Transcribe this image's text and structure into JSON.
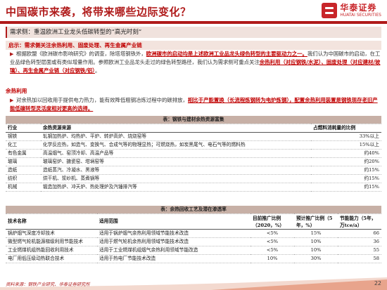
{
  "header": {
    "title": "中国碳市来袭，将带来哪些边际变化？",
    "logo_cn": "华泰证券",
    "logo_en": "HUATAI SECURITIES"
  },
  "section_title": "需求侧：重温欧洲工业龙头低碳转型的“高光时刻”",
  "part1": {
    "heading": "启示：需求侧关注余热利用、固废处理、再生金属产业链",
    "p1_a": "根据欧盟《欧洲碳市影响研究》的调查，除塔塔钢铁外，",
    "p1_b": "欧洲碳市的启动均是上述欧洲工业品龙头绿色转型的主要驱动力之一。",
    "p1_c": "我们认为中国碳市的启动，在工业品绿色转型层面或有类似增量作用。参照欧洲工业品龙头走过的绿色转型路径，我们认为需求侧可重点关注",
    "p1_d": "余热利用（对应钢铁/水泥）、固废处理（对应建材/玻璃）、再生金属产业链（对应钢铁/铝）",
    "p1_e": "。"
  },
  "part2": {
    "heading": "余热利用",
    "p2_a": "对余热加以回收用于提供电力热力，能有效降低粗钢冶炼过程中的碳排放，",
    "p2_b": "相比于产能置换（长流程炼钢转为电炉炼钢），配置余热利用装置是钢铁现存老旧产能低碳转型灵活度相对更高的选择。"
  },
  "table1": {
    "caption": "表：钢铁与建材余热资源富集",
    "columns": [
      "行业",
      "余热资源来源",
      "占燃料消耗量的比例"
    ],
    "rows": [
      [
        "钢铁",
        "轧钢加热炉、均热炉、平炉、转炉高炉、烧烧窑等",
        "33%以上"
      ],
      [
        "化工",
        "化学反应热，如造气、变换气、合成气等的物理显热；可燃烧热，如炭黑尾气、电石气等的燃料热",
        "15%以上"
      ],
      [
        "有色金属",
        "高温烟气、窑顶冷却、高温产品等",
        "约40%"
      ],
      [
        "玻璃",
        "玻璃窑炉、搪瓷窑、坩埚窑等",
        "约20%"
      ],
      [
        "造纸",
        "造纸蒸汽、冷凝水、黑液等",
        "约15%"
      ],
      [
        "纺织",
        "烘干机、浆纱机、蒸煮锅等",
        "约15%"
      ],
      [
        "机械",
        "锻造加热炉、冲天炉、热处理炉及汽锤排汽等",
        "约15%"
      ]
    ]
  },
  "table2": {
    "caption": "表：余热回收工艺及潜在渗透率",
    "columns": [
      "技术名称",
      "适用范围",
      "目前推广比例（2020，%）",
      "预计推广比例（5年，%）",
      "节能能力（5年，万tce/a）"
    ],
    "rows": [
      [
        "锅炉烟气深度冷却技术",
        "适用于锅炉烟气余热利用领域节能技术改造",
        "<5%",
        "15%",
        "66"
      ],
      [
        "微型燃气轮机能源梯级利用节能技术",
        "适用于燃气轮机余热利用领域节能技术改造",
        "<5%",
        "10%",
        "36"
      ],
      [
        "工业燃煤机组热能回收利用技术",
        "适用于工业燃煤机组烟气余热利用领域节能改造",
        "<5%",
        "10%",
        "55"
      ],
      [
        "电厂用低压级动热联合技术",
        "适用于热电厂节能技术改造",
        "10%",
        "30%",
        "58"
      ]
    ]
  },
  "footer": {
    "source": "资料来源：钢铁产业研究、华泰证券研究所",
    "page": "22"
  }
}
